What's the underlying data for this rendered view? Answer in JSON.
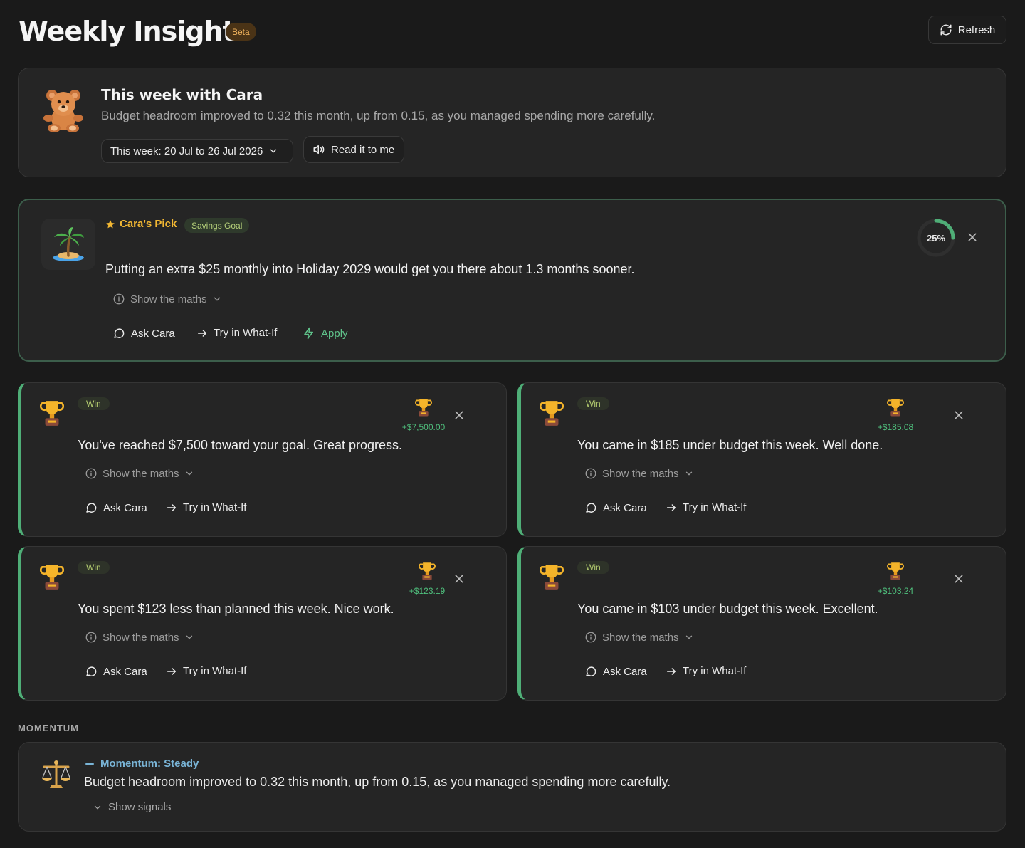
{
  "header": {
    "title": "Weekly Insights",
    "badge": "Beta",
    "refresh_label": "Refresh"
  },
  "summary": {
    "title": "This week with Cara",
    "text": "Budget headroom improved to 0.32 this month, up from 0.15, as you managed spending more carefully.",
    "week_selector": "This week: 20 Jul to 26 Jul 2026",
    "read_label": "Read it to me"
  },
  "pick": {
    "label": "Cara's Pick",
    "tag": "Savings Goal",
    "text": "Putting an extra $25 monthly into Holiday 2029 would get you there about 1.3 months sooner.",
    "progress_percent": 25,
    "progress_text": "25%",
    "maths_label": "Show the maths",
    "actions": {
      "ask": "Ask Cara",
      "whatif": "Try in What-If",
      "apply": "Apply"
    }
  },
  "wins": [
    {
      "tag": "Win",
      "amount": "+$7,500.00",
      "text": "You've reached $7,500 toward your goal. Great progress.",
      "maths_label": "Show the maths",
      "ask": "Ask Cara",
      "whatif": "Try in What-If"
    },
    {
      "tag": "Win",
      "amount": "+$185.08",
      "text": "You came in $185 under budget this week. Well done.",
      "maths_label": "Show the maths",
      "ask": "Ask Cara",
      "whatif": "Try in What-If"
    },
    {
      "tag": "Win",
      "amount": "+$123.19",
      "text": "You spent $123 less than planned this week. Nice work.",
      "maths_label": "Show the maths",
      "ask": "Ask Cara",
      "whatif": "Try in What-If"
    },
    {
      "tag": "Win",
      "amount": "+$103.24",
      "text": "You came in $103 under budget this week. Excellent.",
      "maths_label": "Show the maths",
      "ask": "Ask Cara",
      "whatif": "Try in What-If"
    }
  ],
  "momentum": {
    "section_label": "MOMENTUM",
    "label": "Momentum: Steady",
    "text": "Budget headroom improved to 0.32 this month, up from 0.15, as you managed spending more carefully.",
    "signals_label": "Show signals"
  },
  "colors": {
    "accent_green": "#4fae77",
    "pick_gold": "#f3b833",
    "momentum_blue": "#79b4d6",
    "amount_green": "#4fc07d"
  },
  "icons": [
    "refresh-icon",
    "teddy-bear-icon",
    "chevron-down-icon",
    "speaker-icon",
    "palm-island-icon",
    "star-icon",
    "close-icon",
    "info-icon",
    "chat-bubble-icon",
    "arrow-right-icon",
    "lightning-icon",
    "trophy-icon",
    "scales-icon",
    "dash-icon"
  ]
}
